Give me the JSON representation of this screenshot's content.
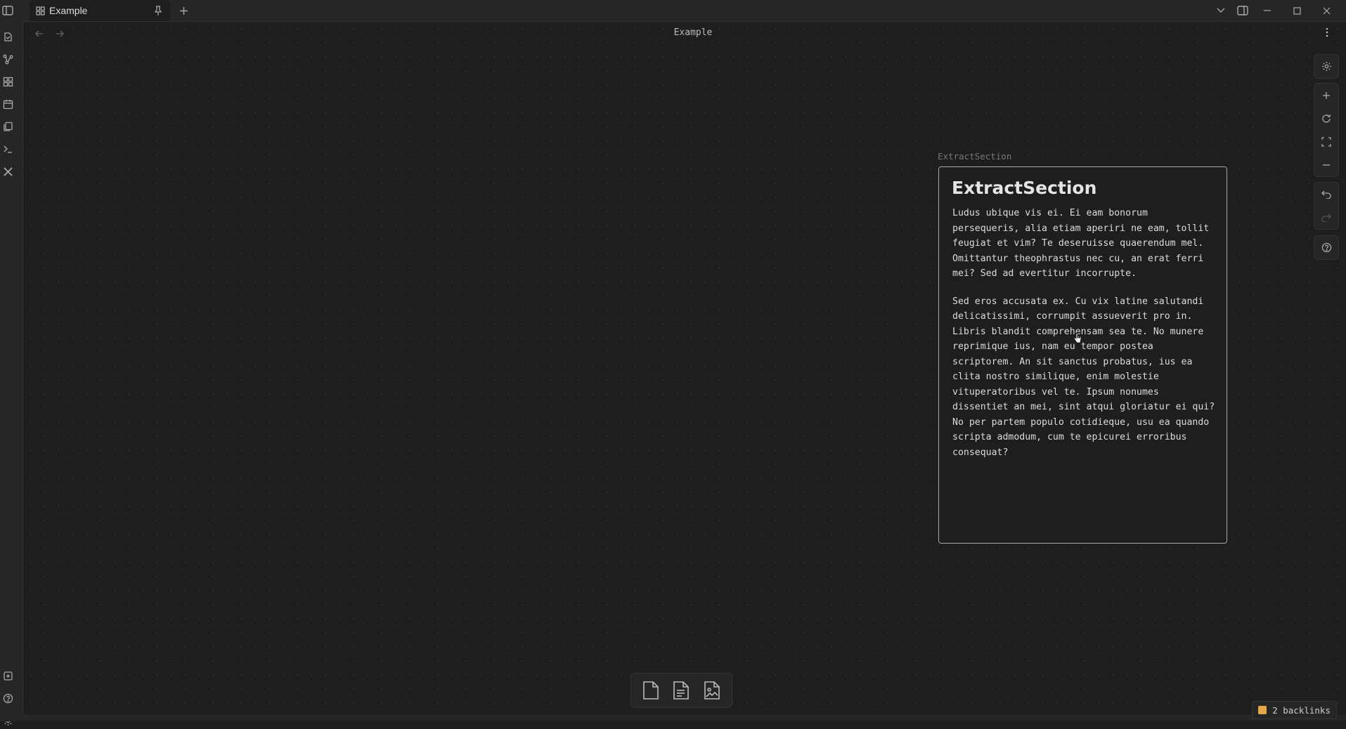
{
  "tab": {
    "label": "Example"
  },
  "view": {
    "title": "Example"
  },
  "node": {
    "label": "ExtractSection",
    "heading": "ExtractSection",
    "paragraph1": "Ludus ubique vis ei. Ei eam bonorum persequeris, alia etiam aperiri ne eam, tollit feugiat et vim? Te deseruisse quaerendum mel. Omittantur theophrastus nec cu, an erat ferri mei? Sed ad evertitur incorrupte.",
    "paragraph2": "Sed eros accusata ex. Cu vix latine salutandi delicatissimi, corrumpit assueverit pro in. Libris blandit comprehensam sea te. No munere reprimique ius, nam eu tempor postea scriptorem. An sit sanctus probatus, ius ea clita nostro similique, enim molestie vituperatoribus vel te. Ipsum nonumes dissentiet an mei, sint atqui gloriatur ei qui? No per partem populo cotidieque, usu ea quando scripta admodum, cum te epicurei erroribus consequat?"
  },
  "status": {
    "backlinks": "2 backlinks"
  },
  "icons": {
    "sidebar_toggle": "sidebar-toggle-icon",
    "canvas_tab": "canvas-icon",
    "pin": "pin-icon",
    "new_tab": "plus-icon",
    "ribbon": [
      "files-icon",
      "graph-icon",
      "canvas-icon",
      "calendar-icon",
      "pages-icon",
      "terminal-icon",
      "tools-icon",
      "vault-icon",
      "help-icon",
      "settings-icon"
    ],
    "controls": [
      "settings-icon",
      "zoom-in-icon",
      "reset-icon",
      "fit-icon",
      "zoom-out-icon",
      "undo-icon",
      "redo-icon",
      "help-icon"
    ],
    "bottom_tools": [
      "file-icon",
      "note-icon",
      "image-icon"
    ]
  },
  "colors": {
    "background": "#1e1e1e",
    "panel": "#262626",
    "card_border": "#a8a8a8",
    "backlink_accent": "#e4a84a"
  }
}
